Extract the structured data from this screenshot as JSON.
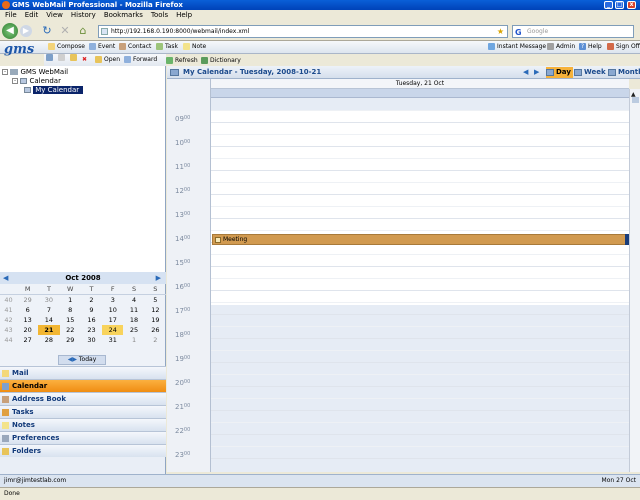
{
  "window": {
    "title": "GMS WebMail Professional - Mozilla Firefox"
  },
  "menubar": [
    "File",
    "Edit",
    "View",
    "History",
    "Bookmarks",
    "Tools",
    "Help"
  ],
  "browser": {
    "url": "http://192.168.0.190:8000/webmail/index.xml",
    "search_placeholder": "Google"
  },
  "app": {
    "logo": "gms",
    "toolbar1": [
      "Compose",
      "Event",
      "Contact",
      "Task",
      "Note"
    ],
    "toolbar_right": [
      "Instant Message",
      "Admin",
      "Help",
      "Sign Off"
    ],
    "toolbar2": [
      "Open",
      "Forward",
      "Refresh",
      "Dictionary"
    ]
  },
  "tree": {
    "root": "GMS WebMail",
    "child": "Calendar",
    "leaf": "My Calendar"
  },
  "minical": {
    "month": "Oct 2008",
    "headers": [
      "",
      "M",
      "T",
      "W",
      "T",
      "F",
      "S",
      "S"
    ],
    "weeks": [
      [
        "40",
        "29",
        "30",
        "1",
        "2",
        "3",
        "4",
        "5"
      ],
      [
        "41",
        "6",
        "7",
        "8",
        "9",
        "10",
        "11",
        "12"
      ],
      [
        "42",
        "13",
        "14",
        "15",
        "16",
        "17",
        "18",
        "19"
      ],
      [
        "43",
        "20",
        "21",
        "22",
        "23",
        "24",
        "25",
        "26"
      ],
      [
        "44",
        "27",
        "28",
        "29",
        "30",
        "31",
        "1",
        "2"
      ]
    ],
    "selected_day": "21",
    "highlight_day": "24",
    "today_label": "Today"
  },
  "modules": [
    "Mail",
    "Calendar",
    "Address Book",
    "Tasks",
    "Notes",
    "Preferences",
    "Folders"
  ],
  "active_module": "Calendar",
  "calendar": {
    "title": "My Calendar - Tuesday, 2008-10-21",
    "views": [
      "Day",
      "Week",
      "Month"
    ],
    "active_view": "Day",
    "day_header": "Tuesday, 21 Oct",
    "hours": [
      "09",
      "10",
      "11",
      "12",
      "13",
      "14",
      "15",
      "16",
      "17",
      "18",
      "19",
      "20",
      "21",
      "22",
      "23"
    ],
    "minutes_label": "00",
    "event": {
      "title": "Meeting",
      "hour": "14",
      "color": "#d19a50"
    }
  },
  "status": {
    "user": "jimr@jimtestlab.com",
    "date": "Mon 27 Oct",
    "browser_status": "Done"
  }
}
